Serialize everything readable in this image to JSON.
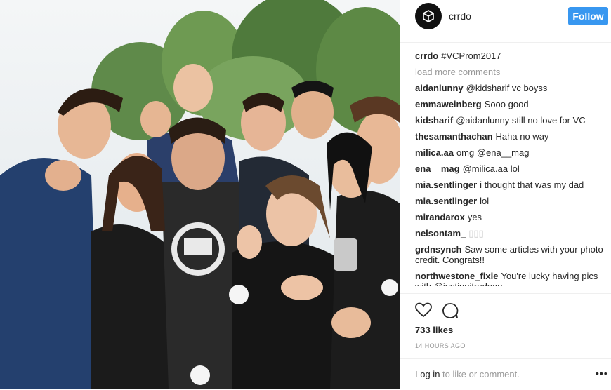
{
  "post": {
    "image_description_icon": "group-selfie-photo",
    "caption": {
      "user": "crrdo",
      "text": "#VCProm2017"
    },
    "load_more": "load more comments",
    "like_count": "733 likes",
    "timestamp": "14 HOURS AGO"
  },
  "header": {
    "avatar_icon": "camera-logo-icon",
    "username": "crrdo",
    "follow_label": "Follow"
  },
  "comments": [
    {
      "user": "aidanlunny",
      "text": "@kidsharif vc boyss"
    },
    {
      "user": "emmaweinberg",
      "text": "Sooo good"
    },
    {
      "user": "kidsharif",
      "text": "@aidanlunny still no love for VC"
    },
    {
      "user": "thesamanthachan",
      "text": "Haha no way"
    },
    {
      "user": "milica.aa",
      "text": "omg @ena__mag"
    },
    {
      "user": "ena__mag",
      "text": "@milica.aa lol"
    },
    {
      "user": "mia.sentlinger",
      "text": "i thought that was my dad"
    },
    {
      "user": "mia.sentlinger",
      "text": "lol"
    },
    {
      "user": "mirandarox",
      "text": "yes"
    },
    {
      "user": "nelsontam_",
      "text": "▯▯▯"
    },
    {
      "user": "grdnsynch",
      "text": "Saw some articles with your photo credit. Congrats!!"
    },
    {
      "user": "northwestone_fixie",
      "text": "You're lucky having pics with @justinpjtrudeau"
    }
  ],
  "actions": {
    "like_icon": "heart-icon",
    "comment_icon": "comment-icon"
  },
  "footer": {
    "login_link": "Log in",
    "login_rest": "to like or comment.",
    "more_icon": "ellipsis-icon",
    "more_text": "•••"
  },
  "colors": {
    "accent": "#3897f0",
    "border": "#efefef",
    "muted": "#999999"
  }
}
